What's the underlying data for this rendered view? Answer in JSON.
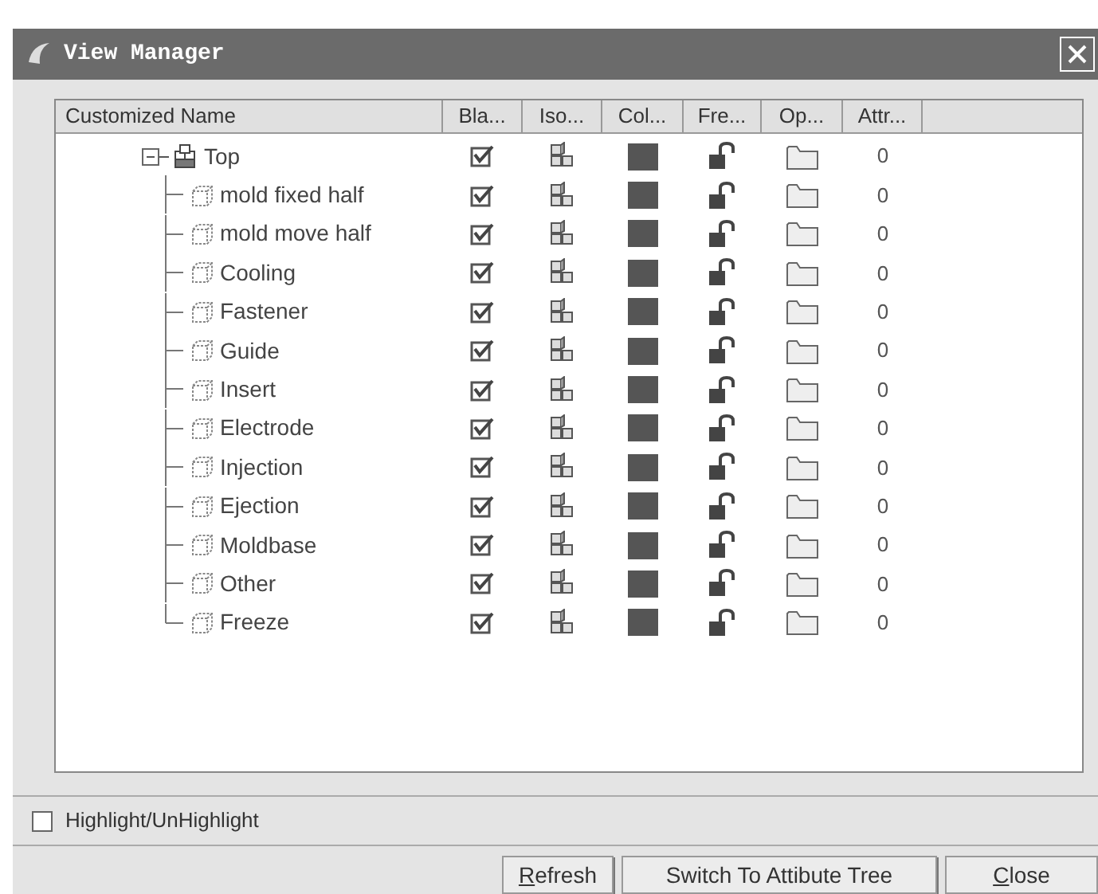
{
  "window": {
    "title": "View Manager"
  },
  "columns": [
    "Customized Name",
    "Bla...",
    "Iso...",
    "Col...",
    "Fre...",
    "Op...",
    "Attr..."
  ],
  "tree": [
    {
      "name": "Top",
      "kind": "assembly",
      "expanded": true,
      "blank": true,
      "color": "#555555",
      "attr": "0",
      "children": [
        {
          "name": "mold fixed half",
          "kind": "part",
          "blank": true,
          "color": "#555555",
          "attr": "0"
        },
        {
          "name": "mold move half",
          "kind": "part",
          "blank": true,
          "color": "#555555",
          "attr": "0"
        },
        {
          "name": "Cooling",
          "kind": "part",
          "blank": true,
          "color": "#555555",
          "attr": "0"
        },
        {
          "name": "Fastener",
          "kind": "part",
          "blank": true,
          "color": "#555555",
          "attr": "0"
        },
        {
          "name": "Guide",
          "kind": "part",
          "blank": true,
          "color": "#555555",
          "attr": "0"
        },
        {
          "name": "Insert",
          "kind": "part",
          "blank": true,
          "color": "#555555",
          "attr": "0"
        },
        {
          "name": "Electrode",
          "kind": "part",
          "blank": true,
          "color": "#555555",
          "attr": "0"
        },
        {
          "name": "Injection",
          "kind": "part",
          "blank": true,
          "color": "#555555",
          "attr": "0"
        },
        {
          "name": "Ejection",
          "kind": "part",
          "blank": true,
          "color": "#555555",
          "attr": "0"
        },
        {
          "name": "Moldbase",
          "kind": "part",
          "blank": true,
          "color": "#555555",
          "attr": "0"
        },
        {
          "name": "Other",
          "kind": "part",
          "blank": true,
          "color": "#555555",
          "attr": "0"
        },
        {
          "name": "Freeze",
          "kind": "part",
          "blank": true,
          "color": "#555555",
          "attr": "0"
        }
      ]
    }
  ],
  "highlight": {
    "label": "Highlight/UnHighlight",
    "checked": false
  },
  "buttons": [
    {
      "label": "Refresh",
      "mnemonic": true
    },
    {
      "label": "Switch To Attibute Tree",
      "mnemonic": false
    },
    {
      "label": "Close",
      "mnemonic": true
    }
  ]
}
